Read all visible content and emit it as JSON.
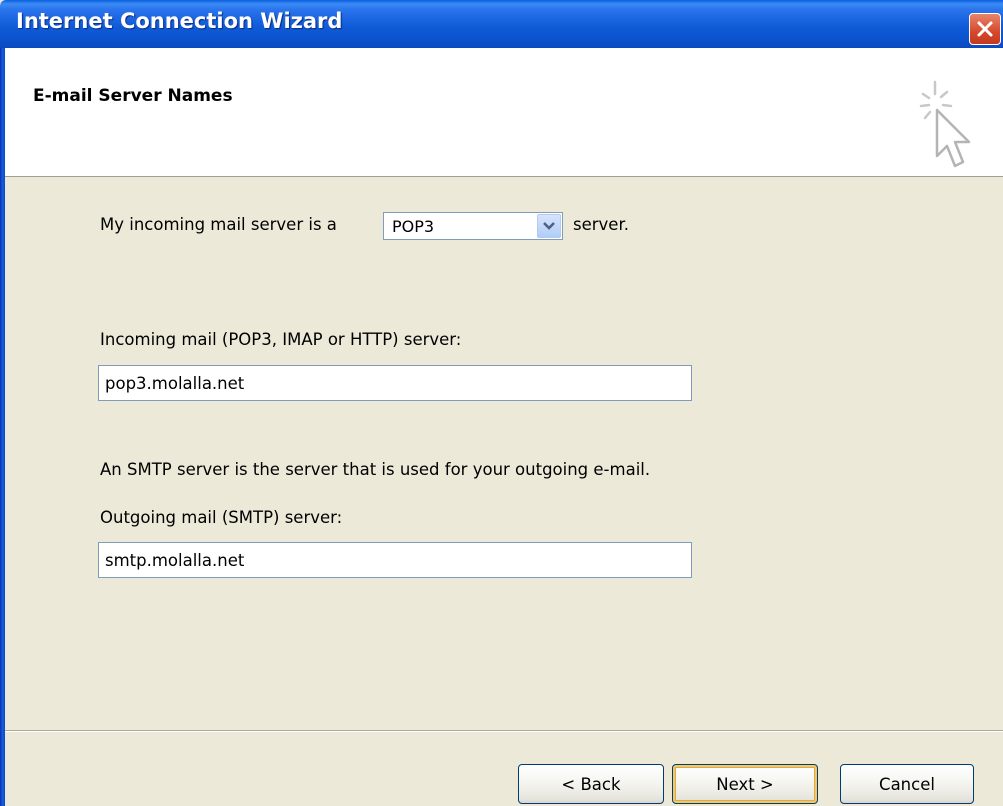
{
  "window": {
    "title": "Internet Connection Wizard",
    "close_icon": "close-icon"
  },
  "header": {
    "heading": "E-mail Server Names",
    "icon": "wizard-cursor-icon"
  },
  "incoming_type": {
    "prefix": "My incoming mail server is a",
    "selected": "POP3",
    "suffix": "server."
  },
  "incoming": {
    "label": "Incoming mail (POP3, IMAP or HTTP) server:",
    "value": "pop3.molalla.net"
  },
  "smtp_note": "An SMTP server is the server that is used for your outgoing e-mail.",
  "outgoing": {
    "label": "Outgoing mail (SMTP) server:",
    "value": "smtp.molalla.net"
  },
  "buttons": {
    "back": "< Back",
    "next": "Next >",
    "cancel": "Cancel"
  },
  "colors": {
    "titlebar": "#0b52cc",
    "dialog_bg": "#ece9d8",
    "close": "#d6482c"
  }
}
